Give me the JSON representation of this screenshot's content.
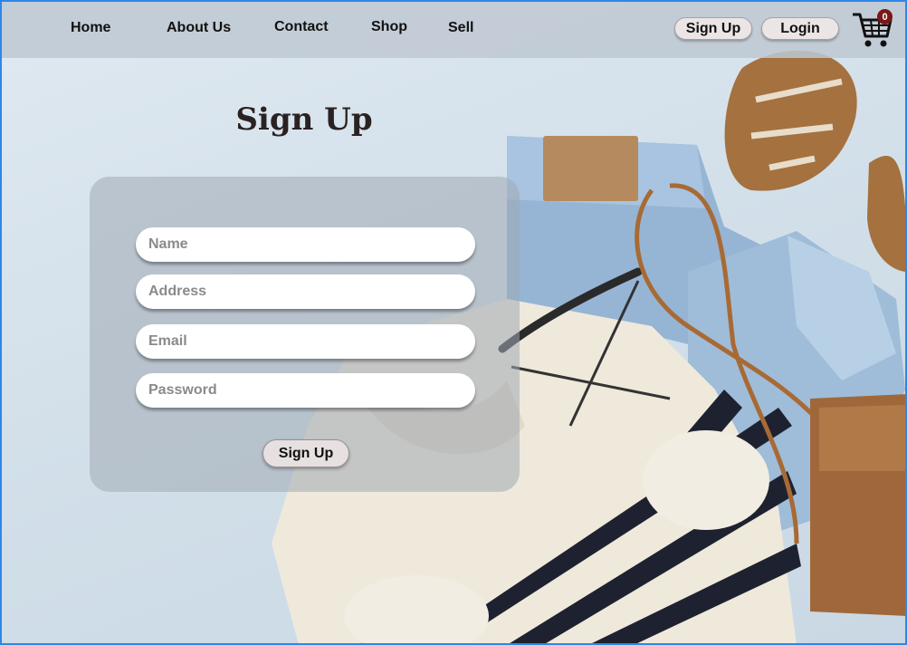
{
  "nav": {
    "links": [
      "Home",
      "About Us",
      "Contact",
      "Shop",
      "Sell"
    ],
    "signup_label": "Sign Up",
    "login_label": "Login",
    "cart_count": "0"
  },
  "page": {
    "title": "Sign Up"
  },
  "form": {
    "name_placeholder": "Name",
    "address_placeholder": "Address",
    "email_placeholder": "Email",
    "password_placeholder": "Password",
    "submit_label": "Sign Up"
  },
  "colors": {
    "frame": "#2f86e8",
    "topbar": "#bec8d2",
    "cart_badge": "#7a1717"
  },
  "icons": {
    "cart": "shopping-cart-icon"
  }
}
